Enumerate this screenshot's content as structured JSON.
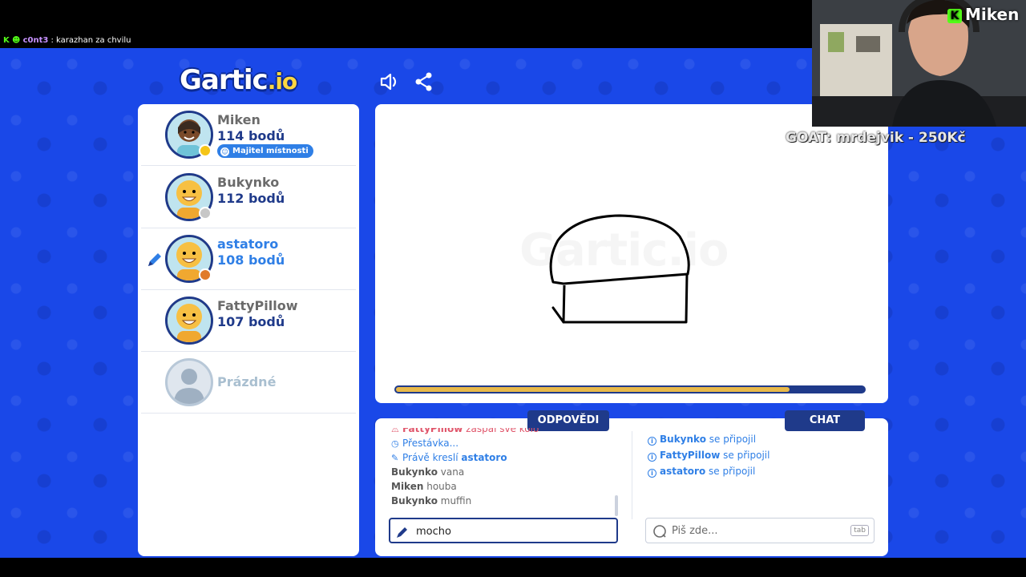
{
  "stream": {
    "chat_user": "c0nt3",
    "chat_message": ": karazhan za chvilu",
    "streamer_name": "Miken",
    "goal_text": "GOAT: mrdejvik - 250Kč"
  },
  "header": {
    "logo_text": "Gartic",
    "logo_suffix": ".io"
  },
  "players": [
    {
      "name": "Miken",
      "score": "114 bodů",
      "badge": "Majitel místnosti",
      "status_color": "#f5c518"
    },
    {
      "name": "Bukynko",
      "score": "112 bodů",
      "status_color": "#c7c7c7"
    },
    {
      "name": "astatoro",
      "score": "108 bodů",
      "status_color": "#e07a2a",
      "drawing": true
    },
    {
      "name": "FattyPillow",
      "score": "107 bodů"
    },
    {
      "name": "Prázdné",
      "empty": true
    }
  ],
  "canvas": {
    "watermark": "Gartic.io",
    "timer_progress": 0.84
  },
  "answers": {
    "tab_label": "ODPOVĚDI",
    "messages": [
      {
        "type": "warn",
        "user": "FattyPillow",
        "text": "zaspal své kolo"
      },
      {
        "type": "sys",
        "text": "Přestávka..."
      },
      {
        "type": "sys",
        "text": "Právě kreslí ",
        "user": "astatoro"
      },
      {
        "type": "guess",
        "user": "Bukynko",
        "text": "vana"
      },
      {
        "type": "guess",
        "user": "Miken",
        "text": "houba"
      },
      {
        "type": "guess",
        "user": "Bukynko",
        "text": "muffin"
      }
    ],
    "input_value": "mocho"
  },
  "chat": {
    "tab_label": "CHAT",
    "messages": [
      {
        "user": "Bukynko",
        "text": " se připojil"
      },
      {
        "user": "FattyPillow",
        "text": " se připojil"
      },
      {
        "user": "astatoro",
        "text": " se připojil"
      }
    ],
    "placeholder": "Piš zde...",
    "tab_hint": "tab"
  }
}
